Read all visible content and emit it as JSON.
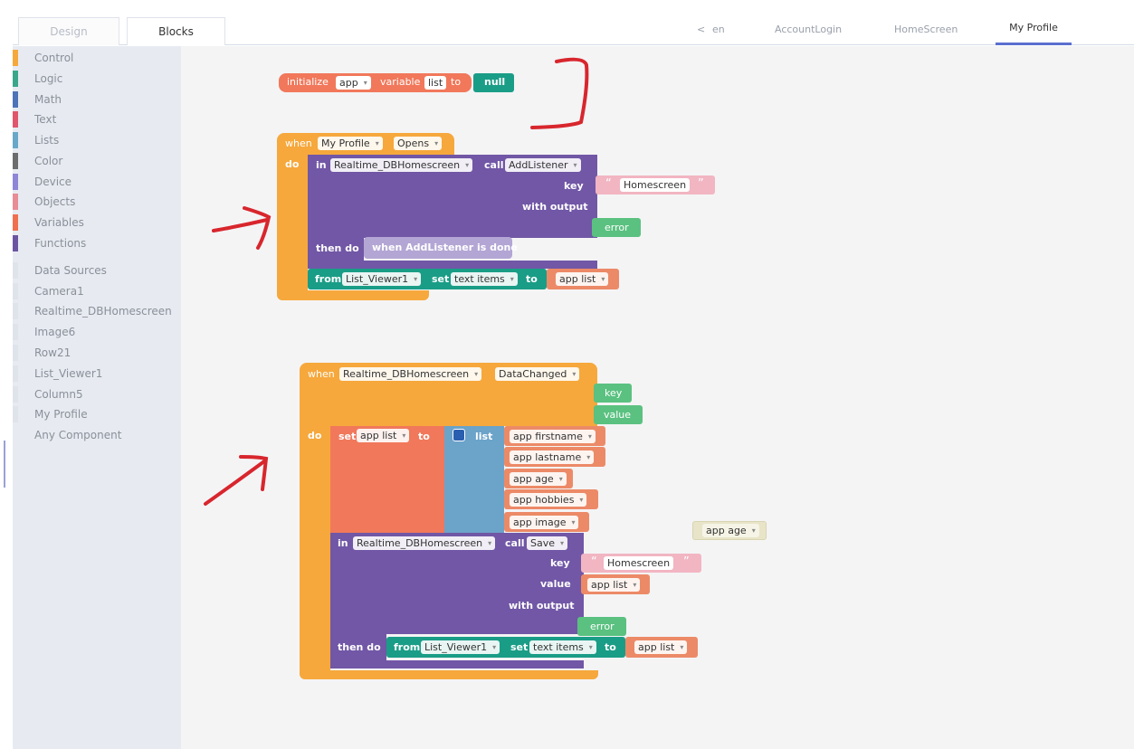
{
  "header": {
    "mode_tabs": [
      "Design",
      "Blocks"
    ],
    "back_arrow": "<",
    "screen_tabs": [
      "en",
      "AccountLogin",
      "HomeScreen",
      "My Profile"
    ],
    "active_screen": "My Profile"
  },
  "sidebar": {
    "categories": [
      {
        "label": "Control",
        "color": "#f6a83c"
      },
      {
        "label": "Logic",
        "color": "#3aa78b"
      },
      {
        "label": "Math",
        "color": "#4d73b8"
      },
      {
        "label": "Text",
        "color": "#e0566d"
      },
      {
        "label": "Lists",
        "color": "#69a8c8"
      },
      {
        "label": "Color",
        "color": "#6d6d6d"
      },
      {
        "label": "Device",
        "color": "#8f86d8"
      },
      {
        "label": "Objects",
        "color": "#e88c96"
      },
      {
        "label": "Variables",
        "color": "#f06f4f"
      },
      {
        "label": "Functions",
        "color": "#6b55a3"
      }
    ],
    "components": [
      "Data Sources",
      "Camera1",
      "Realtime_DBHomescreen",
      "Image6",
      "Row21",
      "List_Viewer1",
      "Column5",
      "My Profile",
      "Any Component"
    ]
  },
  "blocks": {
    "init": {
      "initialize": "initialize",
      "scope": "app",
      "variable": "variable",
      "name": "list",
      "to": "to",
      "value": "null"
    },
    "opens": {
      "when": "when",
      "component": "My Profile",
      "event": "Opens",
      "do": "do",
      "in": "in",
      "db": "Realtime_DBHomescreen",
      "call": "call",
      "method": "AddListener",
      "key_label": "key",
      "key_value": "Homescreen",
      "with_output": "with output",
      "error": "error",
      "then_do": "then do",
      "done": "when AddListener is done",
      "from": "from",
      "viewer": "List_Viewer1",
      "set": "set",
      "prop": "text items",
      "to": "to",
      "var": "app list"
    },
    "datachanged": {
      "when": "when",
      "component": "Realtime_DBHomescreen",
      "event": "DataChanged",
      "key": "key",
      "value": "value",
      "do": "do",
      "set": "set",
      "var": "app list",
      "to": "to",
      "list": "list",
      "items": [
        "app firstname",
        "app lastname",
        "app age",
        "app hobbies",
        "app image"
      ],
      "in": "in",
      "db": "Realtime_DBHomescreen",
      "call": "call",
      "method": "Save",
      "key_label": "key",
      "key_value": "Homescreen",
      "value_label": "value",
      "value_var": "app list",
      "with_output": "with output",
      "error": "error",
      "then_do": "then do",
      "from": "from",
      "viewer": "List_Viewer1",
      "set2": "set",
      "prop": "text items",
      "to2": "to",
      "var2": "app list"
    },
    "loose": {
      "var": "app age"
    },
    "quote_open": "“",
    "quote_close": "”"
  }
}
